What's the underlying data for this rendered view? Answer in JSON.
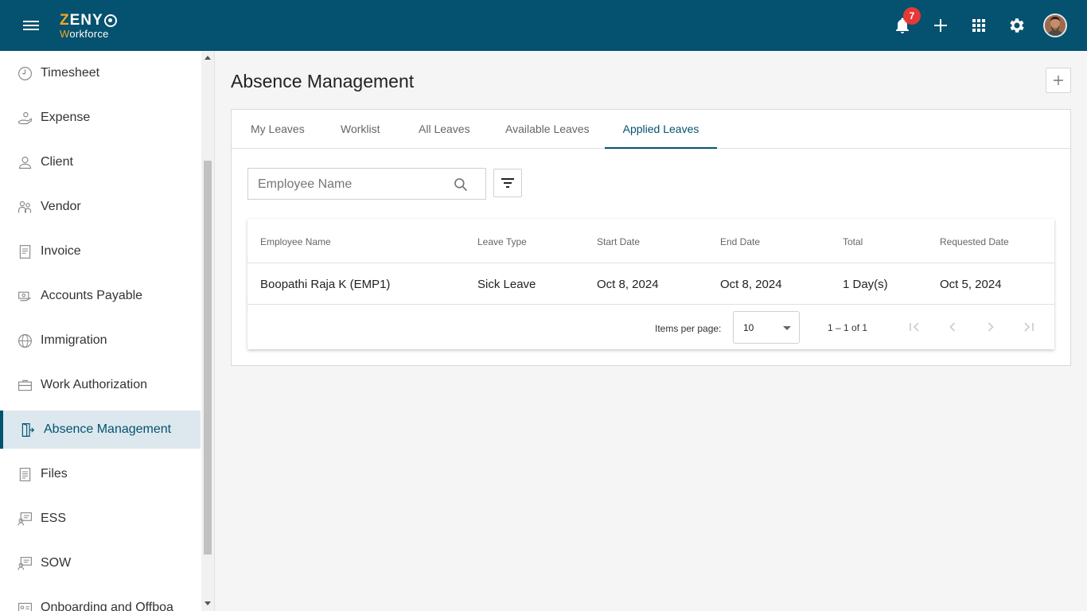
{
  "topbar": {
    "logo_top": "ZENY",
    "logo_bottom": "Workforce",
    "notification_count": "7"
  },
  "sidebar": {
    "items": [
      {
        "label": "Timesheet",
        "icon": "clock-icon"
      },
      {
        "label": "Expense",
        "icon": "hand-coin-icon"
      },
      {
        "label": "Client",
        "icon": "person-icon"
      },
      {
        "label": "Vendor",
        "icon": "vendor-icon"
      },
      {
        "label": "Invoice",
        "icon": "invoice-icon"
      },
      {
        "label": "Accounts Payable",
        "icon": "payment-icon"
      },
      {
        "label": "Immigration",
        "icon": "globe-icon"
      },
      {
        "label": "Work Authorization",
        "icon": "briefcase-icon"
      },
      {
        "label": "Absence Management",
        "icon": "exit-door-icon",
        "active": true
      },
      {
        "label": "Files",
        "icon": "file-icon"
      },
      {
        "label": "ESS",
        "icon": "monitor-people-icon"
      },
      {
        "label": "SOW",
        "icon": "monitor-people-icon"
      },
      {
        "label": "Onboarding and Offboa",
        "icon": "id-card-icon"
      }
    ]
  },
  "main": {
    "title": "Absence Management",
    "tabs": [
      {
        "label": "My Leaves"
      },
      {
        "label": "Worklist"
      },
      {
        "label": "All Leaves"
      },
      {
        "label": "Available Leaves"
      },
      {
        "label": "Applied Leaves",
        "active": true
      }
    ],
    "search": {
      "placeholder": "Employee Name"
    },
    "table": {
      "columns": [
        "Employee Name",
        "Leave Type",
        "Start Date",
        "End Date",
        "Total",
        "Requested Date"
      ],
      "rows": [
        [
          "Boopathi Raja K (EMP1)",
          "Sick Leave",
          "Oct 8, 2024",
          "Oct 8, 2024",
          "1 Day(s)",
          "Oct 5, 2024"
        ]
      ]
    },
    "pagination": {
      "items_per_page_label": "Items per page:",
      "items_per_page": "10",
      "range": "1 – 1 of 1"
    }
  },
  "colors": {
    "header": "#04526f",
    "accent": "#04526f",
    "badge": "#e53935",
    "logo_accent": "#f5a623"
  }
}
